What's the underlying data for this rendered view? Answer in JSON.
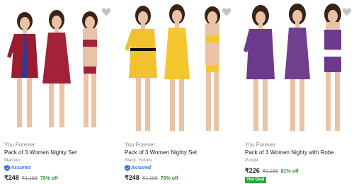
{
  "products": [
    {
      "brand": "You Forever",
      "title": "Pack of 3 Women Nighty Set",
      "color": "Maroon",
      "assured_label": "Assured",
      "price": "₹248",
      "mrp": "₹1,199",
      "discount": "79% off",
      "primary_color": "#9b1c2e"
    },
    {
      "brand": "You Forever",
      "title": "Pack of 3 Women Nighty Set",
      "color": "Black, Yellow",
      "assured_label": "Assured",
      "price": "₹248",
      "mrp": "₹1,199",
      "discount": "79% off",
      "primary_color": "#f2c12e"
    },
    {
      "brand": "You Forever",
      "title": "Pack of 3 Women Nighty with Robe",
      "color": "Purple",
      "price": "₹226",
      "mrp": "₹1,199",
      "discount": "81% off",
      "badge": "Hot Deal",
      "primary_color": "#6b3a8c"
    }
  ],
  "colors": {
    "accent_blue": "#2874f0",
    "discount_green": "#388e3c",
    "hot_deal_green": "#26a541",
    "muted_text": "#878787"
  },
  "icons": {
    "wishlist": "heart-icon",
    "assured": "shield-icon"
  }
}
